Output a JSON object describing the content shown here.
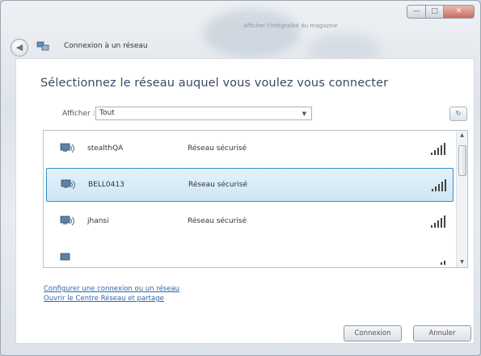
{
  "window": {
    "title": "Connexion à un réseau",
    "background_hint": "Afficher l'intégralité du magazine",
    "caption_buttons": {
      "minimize": "—",
      "maximize": "□",
      "close": "✕"
    }
  },
  "content": {
    "heading": "Sélectionnez le réseau auquel vous voulez vous connecter",
    "filter": {
      "label": "Afficher :",
      "selected": "Tout"
    },
    "refresh_icon": "refresh-icon"
  },
  "networks": [
    {
      "name": "stealthQA",
      "status": "Réseau sécurisé",
      "signal_bars": 5,
      "selected": false
    },
    {
      "name": "BELL0413",
      "status": "Réseau sécurisé",
      "signal_bars": 5,
      "selected": true
    },
    {
      "name": "jhansi",
      "status": "Réseau sécurisé",
      "signal_bars": 5,
      "selected": false
    },
    {
      "name": "",
      "status": "",
      "signal_bars": 2,
      "selected": false
    }
  ],
  "links": {
    "configure": "Configurer une connexion ou un réseau",
    "open_center": "Ouvrir le Centre Réseau et partage"
  },
  "buttons": {
    "connect": "Connexion",
    "cancel": "Annuler"
  },
  "colors": {
    "selection_border": "#2e8fd0",
    "link": "#3066a8",
    "heading": "#3b4a66"
  }
}
